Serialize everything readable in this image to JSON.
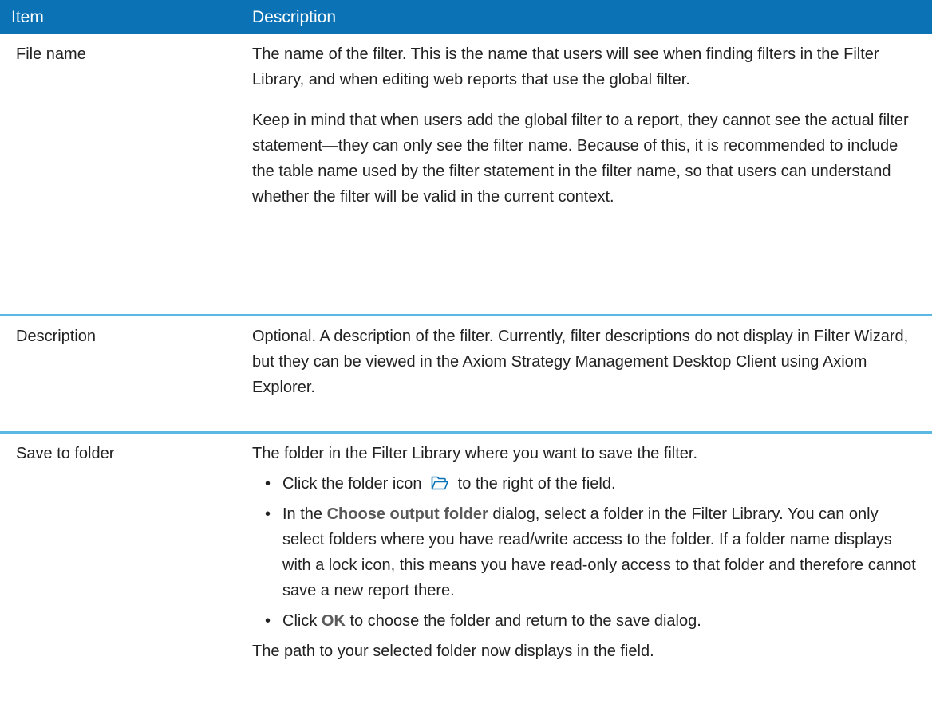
{
  "table": {
    "headers": {
      "item": "Item",
      "description": "Description"
    },
    "rows": [
      {
        "item": "File name",
        "paragraphs": [
          "The name of the filter. This is the name that users will see when finding filters in the Filter Library, and when editing web reports that use the global filter.",
          "Keep in mind that when users add the global filter to a report, they cannot see the actual filter statement—they can only see the filter name. Because of this, it is recommended to include the table name used by the filter statement in the filter name, so that users can understand whether the filter will be valid in the current context."
        ]
      },
      {
        "item": "Description",
        "paragraphs": [
          "Optional. A description of the filter. Currently, filter descriptions do not display in Filter Wizard, but they can be viewed in the Axiom Strategy Management Desktop Client using Axiom Explorer."
        ]
      },
      {
        "item": "Save to folder",
        "intro": "The folder in the Filter Library where you want to save the filter.",
        "bullets": [
          {
            "before": "Click the folder icon",
            "icon": "folder-open-icon",
            "after": "to the right of the field."
          },
          {
            "before": "In the",
            "ui": "Choose output folder",
            "after": "dialog, select a folder in the Filter Library. You can only select folders where you have read/write access to the folder. If a folder name displays with a lock icon, this means you have read-only access to that folder and therefore cannot save a new report there."
          },
          {
            "before": "Click",
            "ui": "OK",
            "after": "to choose the folder and return to the save dialog."
          }
        ],
        "outro": "The path to your selected folder now displays in the field."
      }
    ]
  },
  "colors": {
    "header_bg": "#0b72b5",
    "row_separator": "#5bb8e3",
    "ui_text": "#5a5a5a"
  }
}
